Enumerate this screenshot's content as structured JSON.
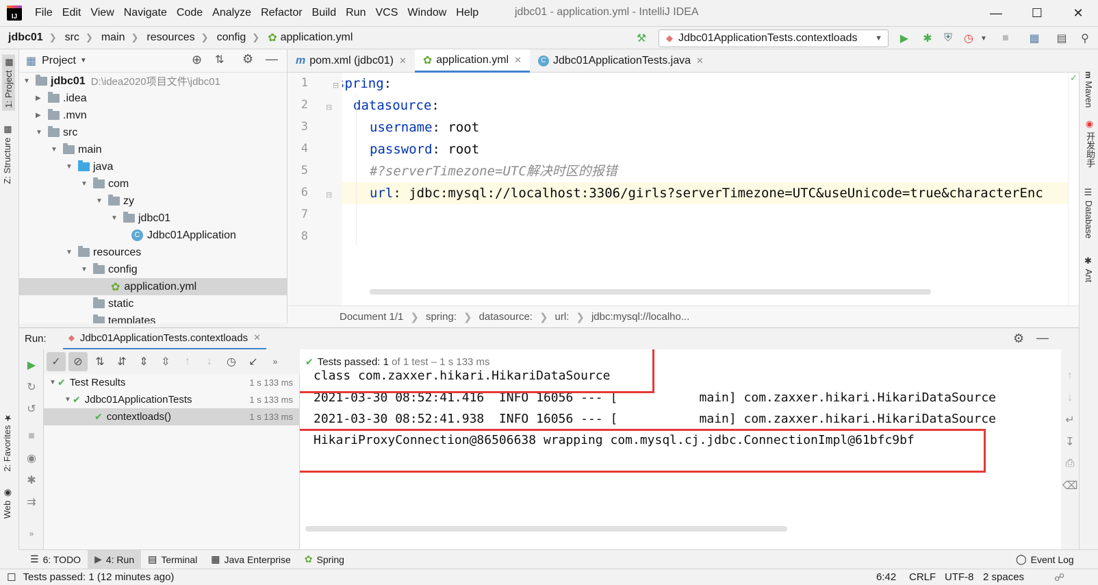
{
  "menu": {
    "items": [
      "File",
      "Edit",
      "View",
      "Navigate",
      "Code",
      "Analyze",
      "Refactor",
      "Build",
      "Run",
      "VCS",
      "Window",
      "Help"
    ],
    "window_title": "jdbc01 - application.yml - IntelliJ IDEA"
  },
  "navbar": {
    "crumbs": [
      "jdbc01",
      "src",
      "main",
      "resources",
      "config",
      "application.yml"
    ],
    "run_config": "Jdbc01ApplicationTests.contextloads"
  },
  "left_strip": {
    "project_tab": "1: Project",
    "structure_tab": "Z: Structure",
    "favorites_tab": "2: Favorites",
    "web_tab": "Web"
  },
  "right_strip": {
    "maven": "Maven",
    "helper": "开发助手",
    "database": "Database",
    "ant": "Ant"
  },
  "project": {
    "title": "Project",
    "tree": [
      {
        "label": "jdbc01",
        "extra": "D:\\idea2020项目文件\\jdbc01"
      },
      {
        "label": ".idea"
      },
      {
        "label": ".mvn"
      },
      {
        "label": "src"
      },
      {
        "label": "main"
      },
      {
        "label": "java"
      },
      {
        "label": "com"
      },
      {
        "label": "zy"
      },
      {
        "label": "jdbc01"
      },
      {
        "label": "Jdbc01Application"
      },
      {
        "label": "resources"
      },
      {
        "label": "config"
      },
      {
        "label": "application.yml"
      },
      {
        "label": "static"
      },
      {
        "label": "templates"
      }
    ]
  },
  "editor": {
    "tabs": [
      "pom.xml (jdbc01)",
      "application.yml",
      "Jdbc01ApplicationTests.java"
    ],
    "line_numbers": [
      "1",
      "2",
      "3",
      "4",
      "5",
      "6",
      "7",
      "8"
    ],
    "code": {
      "l1_key": "spring",
      "l2_key": "datasource",
      "l3_key": "username",
      "l3_val": "root",
      "l4_key": "password",
      "l4_val": "root",
      "l5_comment": "#?serverTimezone=UTC解决时区的报错",
      "l6_key": "url",
      "l6_val": "jdbc:mysql://localhost:3306/girls?serverTimezone=UTC&useUnicode=true&characterEnc"
    },
    "breadcrumb": [
      "Document 1/1",
      "spring:",
      "datasource:",
      "url:",
      "jdbc:mysql://localho..."
    ]
  },
  "run": {
    "label": "Run:",
    "tab": "Jdbc01ApplicationTests.contextloads",
    "tests": [
      {
        "label": "Test Results",
        "time": "1 s 133 ms"
      },
      {
        "label": "Jdbc01ApplicationTests",
        "time": "1 s 133 ms"
      },
      {
        "label": "contextloads()",
        "time": "1 s 133 ms"
      }
    ],
    "status_prefix": "Tests passed:",
    "status_count": "1",
    "status_suffix": "of 1 test – 1 s 133 ms",
    "console": [
      "class com.zaxxer.hikari.HikariDataSource",
      "2021-03-30 08:52:41.416  INFO 16056 --- [           main] com.zaxxer.hikari.HikariDataSource",
      "2021-03-30 08:52:41.938  INFO 16056 --- [           main] com.zaxxer.hikari.HikariDataSource",
      "HikariProxyConnection@86506638 wrapping com.mysql.cj.jdbc.ConnectionImpl@61bfc9bf"
    ]
  },
  "toolwindows": {
    "todo": "6: TODO",
    "run": "4: Run",
    "terminal": "Terminal",
    "java_enterprise": "Java Enterprise",
    "spring": "Spring",
    "event_log": "Event Log"
  },
  "status": {
    "message": "Tests passed: 1 (12 minutes ago)",
    "position": "6:42",
    "line_sep": "CRLF",
    "encoding": "UTF-8",
    "indent": "2 spaces"
  },
  "colors": {
    "accent": "#4083c9",
    "keyword": "#0033b3",
    "pass": "#4caf50",
    "highlight_box": "#e53935"
  }
}
